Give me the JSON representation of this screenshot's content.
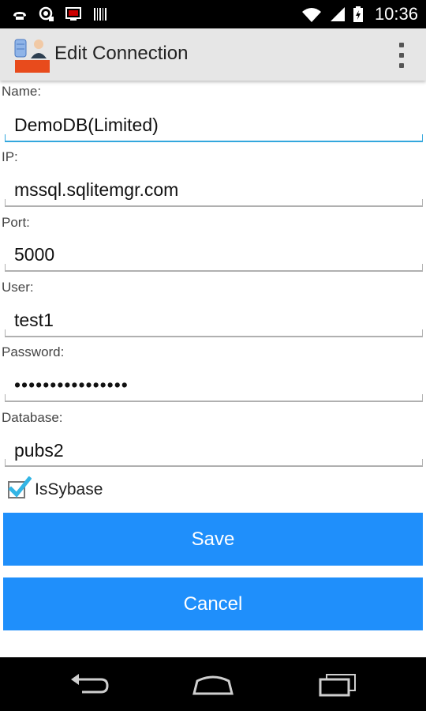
{
  "status_bar": {
    "time": "10:36",
    "icons": [
      "voicemail-icon",
      "camera-app-icon",
      "screen-icon",
      "barcode-icon",
      "wifi-icon",
      "signal-icon",
      "battery-icon"
    ]
  },
  "action_bar": {
    "title": "Edit Connection",
    "app_icon_text": "SQL Server"
  },
  "form": {
    "name": {
      "label": "Name:",
      "value": "DemoDB(Limited)"
    },
    "ip": {
      "label": "IP:",
      "value": "mssql.sqlitemgr.com"
    },
    "port": {
      "label": "Port:",
      "value": "5000"
    },
    "user": {
      "label": "User:",
      "value": "test1"
    },
    "password": {
      "label": "Password:",
      "value": "••••••••••••••••"
    },
    "database": {
      "label": "Database:",
      "value": "pubs2"
    },
    "is_sybase": {
      "label": "IsSybase",
      "checked": true
    }
  },
  "buttons": {
    "save": "Save",
    "cancel": "Cancel"
  },
  "colors": {
    "accent": "#1f8ffb",
    "focus_underline": "#33a7dd",
    "checkmark": "#33b5e5"
  }
}
